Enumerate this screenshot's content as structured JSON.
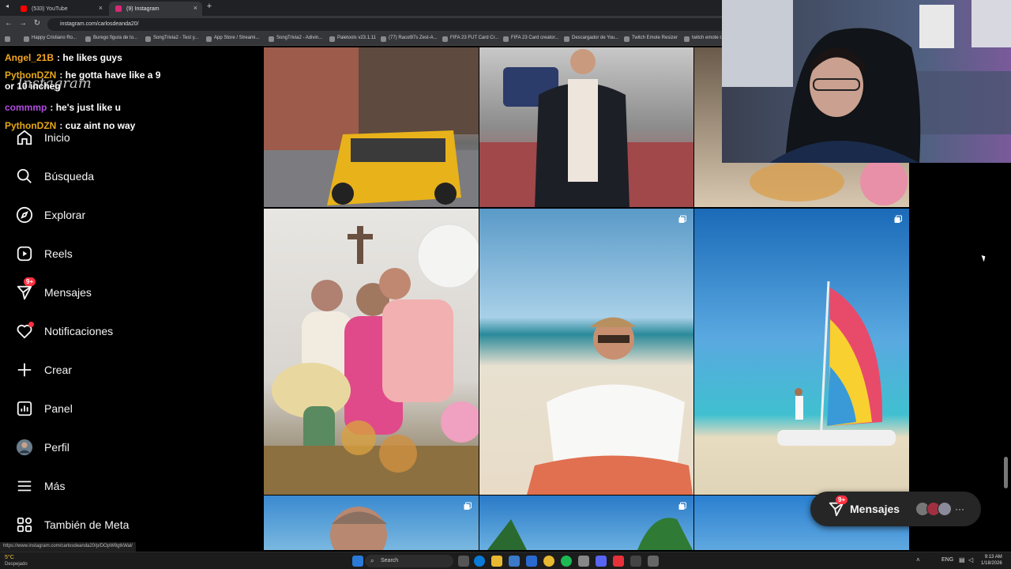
{
  "browser": {
    "tabs": [
      {
        "label": "(533) YouTube",
        "active": false,
        "color": "#ff0000"
      },
      {
        "label": "(9) Instagram",
        "active": true,
        "color": "#d62976"
      }
    ],
    "url": "instagram.com/carlosdeanda20/",
    "bookmarks": [
      "Happy Cristiano Ro...",
      "Burego figura de to...",
      "SongTrivia2 - Test y...",
      "App Store / Streami...",
      "SongTrivia2 - Adivin...",
      "Paletools v23.1.11",
      "(77) Racol97s Zest-A...",
      "FIFA 23 FUT Card Cr...",
      "FIFA 23 Card creator...",
      "Descargador de You...",
      "Twitch Emote Resizer",
      "twitch emote r..."
    ]
  },
  "chat": [
    {
      "user": "Angel_21B",
      "color": "#f5a623",
      "text": "he likes guys"
    },
    {
      "user": "PythonDZN",
      "color": "#e6a817",
      "text": "he gotta have like a 9 or 10 incheg"
    },
    {
      "user": "commmp",
      "color": "#b04de0",
      "text": "he's just like u"
    },
    {
      "user": "PythonDZN",
      "color": "#e6a817",
      "text": "cuz aint no way"
    }
  ],
  "sidebar": {
    "logo": "Instagram",
    "items": [
      {
        "label": "Inicio",
        "icon": "home-icon"
      },
      {
        "label": "Búsqueda",
        "icon": "search-icon"
      },
      {
        "label": "Explorar",
        "icon": "compass-icon"
      },
      {
        "label": "Reels",
        "icon": "reels-icon"
      },
      {
        "label": "Mensajes",
        "icon": "messenger-icon",
        "badge": "9+"
      },
      {
        "label": "Notificaciones",
        "icon": "heart-icon"
      },
      {
        "label": "Crear",
        "icon": "plus-icon"
      },
      {
        "label": "Panel",
        "icon": "dashboard-icon"
      },
      {
        "label": "Perfil",
        "icon": "avatar-icon"
      },
      {
        "label": "Más",
        "icon": "menu-icon"
      },
      {
        "label": "También de Meta",
        "icon": "meta-apps-icon"
      }
    ]
  },
  "messages_pill": {
    "label": "Mensajes",
    "badge": "9+"
  },
  "status_url": "https://www.instagram.com/carlosdeanda20/p/DOpW8gtkWal/",
  "taskbar": {
    "search": "Search",
    "weather_temp": "5°C",
    "weather_desc": "Despejado",
    "lang": "ENG",
    "time": "9:13 AM",
    "date": "1/18/2026"
  },
  "colors": {
    "accent_red": "#ff3040",
    "sidebar_bg": "#000000",
    "pill_bg": "#262626"
  }
}
